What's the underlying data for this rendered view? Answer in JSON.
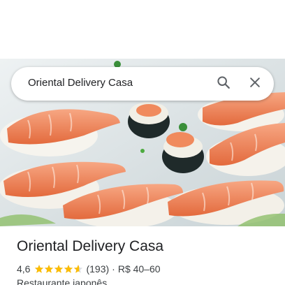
{
  "search": {
    "query": "Oriental Delivery Casa",
    "search_icon": "search-icon",
    "close_icon": "close-icon"
  },
  "place": {
    "name": "Oriental Delivery Casa",
    "rating": "4,6",
    "stars_value": 4.6,
    "stars_max": 5,
    "review_count": "(193)",
    "separator": "·",
    "price_range": "R$ 40–60",
    "category": "Restaurante japonês"
  },
  "colors": {
    "star": "#fbbc04",
    "text_primary": "#202124",
    "text_secondary": "#3c4043",
    "icon": "#5f6368"
  }
}
